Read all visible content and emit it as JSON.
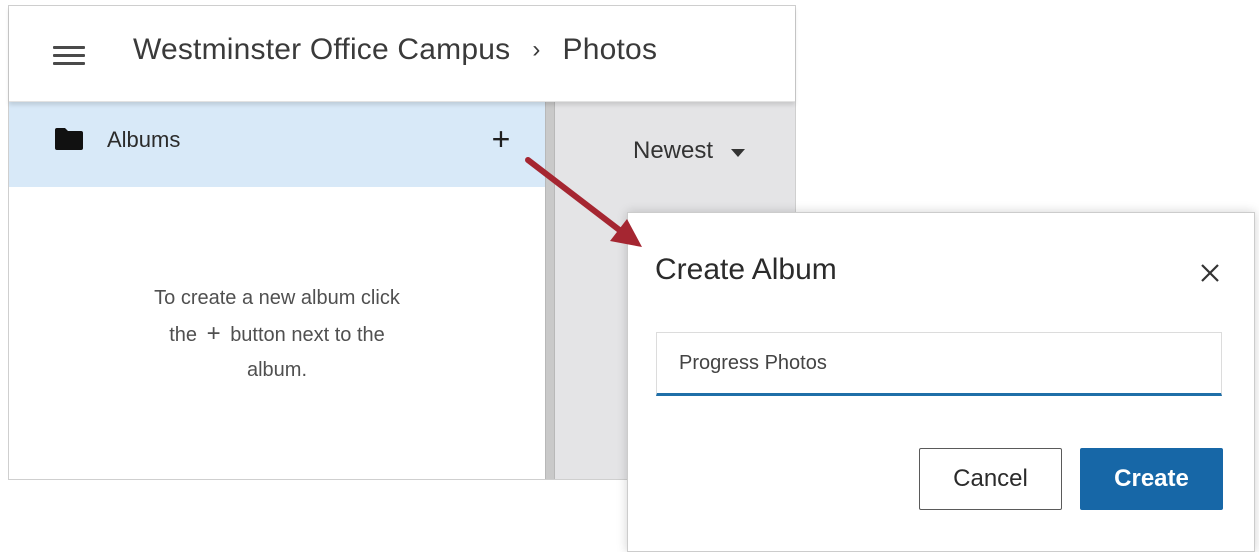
{
  "header": {
    "breadcrumb": [
      "Westminster Office Campus",
      "Photos"
    ],
    "separator": "›"
  },
  "sidebar": {
    "albums_label": "Albums",
    "add_label": "+",
    "empty_message": {
      "line1": "To create a new album click",
      "line2_before": "the",
      "line2_plus": "+",
      "line2_after": "button next to the",
      "line3": "album."
    }
  },
  "sort": {
    "selected": "Newest"
  },
  "modal": {
    "title": "Create Album",
    "input_value": "Progress Photos",
    "cancel_label": "Cancel",
    "create_label": "Create"
  },
  "colors": {
    "accent": "#1767a7",
    "selected_row": "#d8e9f8",
    "arrow": "#a52631"
  },
  "icons": [
    "menu-icon",
    "folder-icon",
    "plus-icon",
    "chevron-down-icon",
    "close-icon",
    "arrow-annotation"
  ]
}
